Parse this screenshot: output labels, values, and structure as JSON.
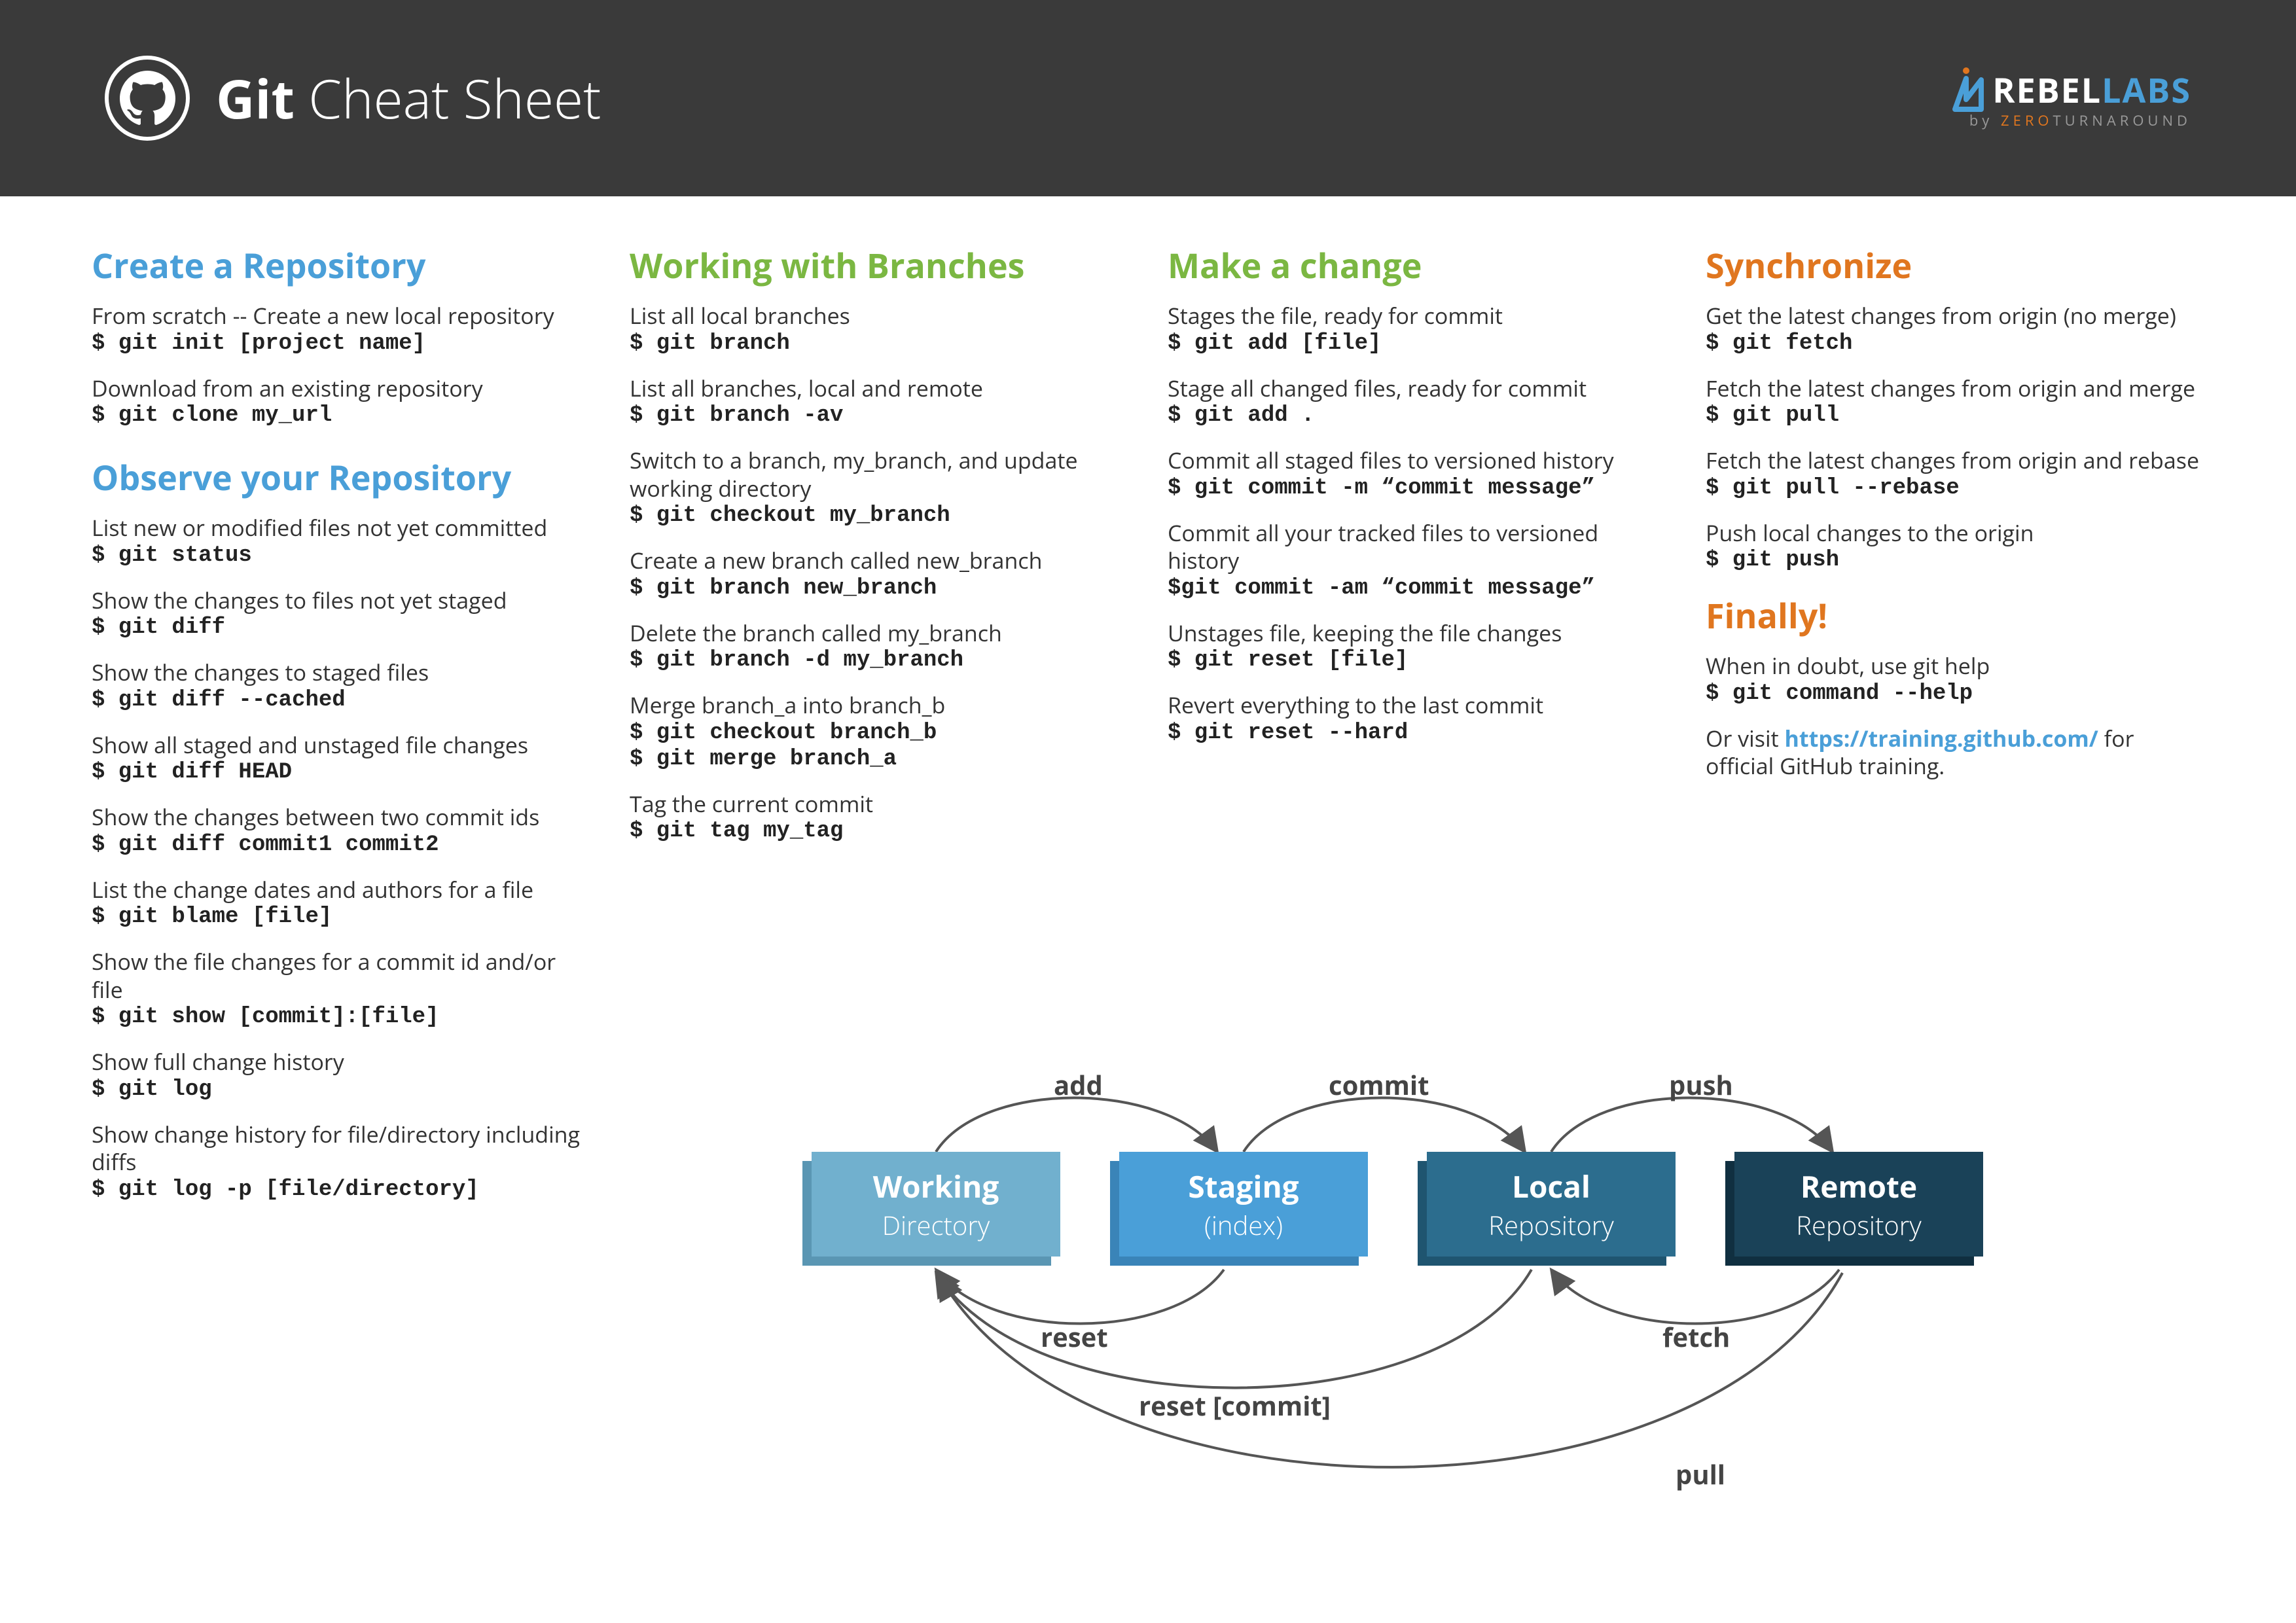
{
  "header": {
    "title_bold": "Git",
    "title_rest": " Cheat Sheet",
    "logo_rebel": "REBEL",
    "logo_labs": "LABS",
    "logo_by": "by ",
    "logo_zero": "ZERO",
    "logo_turn": "TURNAROUND"
  },
  "sections": {
    "create": {
      "title": "Create a Repository",
      "items": [
        {
          "desc": "From scratch -- Create a new local repository",
          "cmd": "$ git init [project name]"
        },
        {
          "desc": "Download from an existing repository",
          "cmd": "$ git clone my_url"
        }
      ]
    },
    "observe": {
      "title": "Observe your Repository",
      "items": [
        {
          "desc": "List new or modified files not yet committed",
          "cmd": "$ git status"
        },
        {
          "desc": "Show the changes to files not yet staged",
          "cmd": "$ git diff"
        },
        {
          "desc": "Show the changes to staged files",
          "cmd": "$ git diff --cached"
        },
        {
          "desc": "Show all staged and unstaged file changes",
          "cmd": "$ git diff HEAD"
        },
        {
          "desc": "Show the changes between two commit ids",
          "cmd": "$ git diff commit1 commit2"
        },
        {
          "desc": "List the change dates and authors for a file",
          "cmd": "$ git blame [file]"
        },
        {
          "desc": "Show the file changes for a commit id and/or file",
          "cmd": "$ git show [commit]:[file]"
        },
        {
          "desc": "Show full change history",
          "cmd": "$ git log"
        },
        {
          "desc": "Show change history for file/directory including diffs",
          "cmd": "$ git log -p [file/directory]"
        }
      ]
    },
    "branches": {
      "title": "Working with Branches",
      "items": [
        {
          "desc": "List all local branches",
          "cmd": "$ git branch"
        },
        {
          "desc": "List all branches, local and remote",
          "cmd": "$ git branch -av"
        },
        {
          "desc": "Switch to a branch, my_branch, and update working directory",
          "cmd": "$ git checkout my_branch"
        },
        {
          "desc": "Create a new branch called new_branch",
          "cmd": "$ git branch new_branch"
        },
        {
          "desc": "Delete the branch called my_branch",
          "cmd": "$ git branch -d my_branch"
        },
        {
          "desc": "Merge branch_a into branch_b",
          "cmd": "$ git checkout branch_b",
          "cmd2": "$ git merge branch_a"
        },
        {
          "desc": "Tag the current commit",
          "cmd": "$ git tag my_tag"
        }
      ]
    },
    "change": {
      "title": "Make a change",
      "items": [
        {
          "desc": "Stages the file, ready for commit",
          "cmd": "$ git add [file]"
        },
        {
          "desc": "Stage all changed files, ready for commit",
          "cmd": "$ git add ."
        },
        {
          "desc": "Commit all staged files to versioned history",
          "cmd": "$ git commit -m “commit message”"
        },
        {
          "desc": "Commit all your tracked files to versioned history",
          "cmd": "$git commit -am “commit message”"
        },
        {
          "desc": "Unstages file, keeping the file changes",
          "cmd": "$ git reset [file]"
        },
        {
          "desc": "Revert everything to the last commit",
          "cmd": "$ git reset --hard"
        }
      ]
    },
    "sync": {
      "title": "Synchronize",
      "items": [
        {
          "desc": "Get the latest changes from origin (no merge)",
          "cmd": "$ git fetch"
        },
        {
          "desc": "Fetch the latest changes from origin and merge",
          "cmd": "$ git pull"
        },
        {
          "desc": "Fetch the latest changes from origin and rebase",
          "cmd": "$ git pull --rebase"
        },
        {
          "desc": "Push local changes to the origin",
          "cmd": "$ git push"
        }
      ]
    },
    "finally": {
      "title": "Finally!",
      "items": [
        {
          "desc": "When in doubt, use git help",
          "cmd": "$ git command --help"
        }
      ],
      "visit_pre": "Or visit ",
      "visit_link": "https://training.github.com/",
      "visit_post": " for official GitHub training."
    }
  },
  "diagram": {
    "boxes": [
      {
        "t1": "Working",
        "t2": "Directory"
      },
      {
        "t1": "Staging",
        "t2": "(index)"
      },
      {
        "t1": "Local",
        "t2": "Repository"
      },
      {
        "t1": "Remote",
        "t2": "Repository"
      }
    ],
    "labels": {
      "add": "add",
      "commit": "commit",
      "push": "push",
      "reset": "reset",
      "fetch": "fetch",
      "reset_commit": "reset [commit]",
      "pull": "pull"
    }
  }
}
